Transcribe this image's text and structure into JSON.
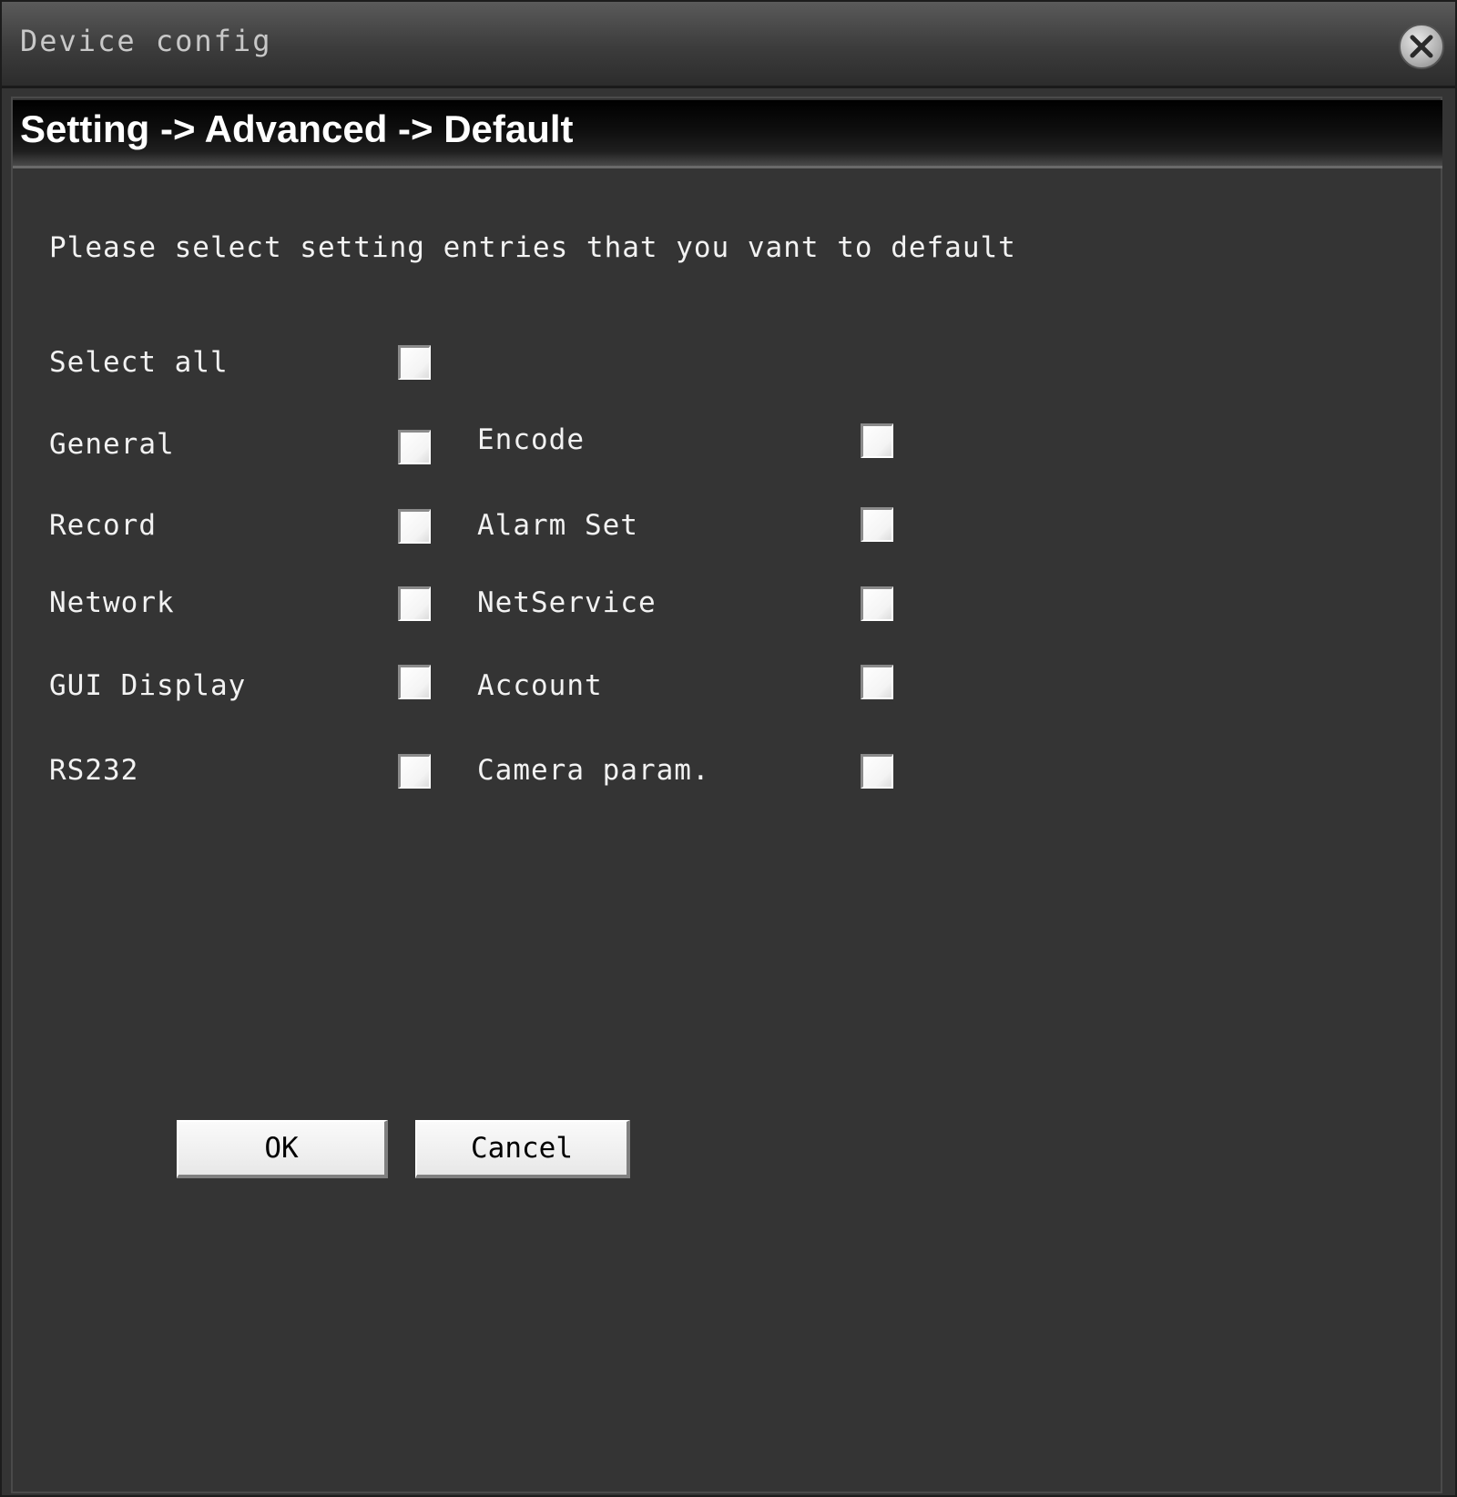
{
  "window": {
    "title": "Device config",
    "close_icon": "close-icon"
  },
  "breadcrumb": "Setting -> Advanced -> Default",
  "instruction": "Please select setting entries that you vant to default",
  "options": {
    "select_all": {
      "label": "Select all",
      "checked": false
    },
    "general": {
      "label": "General",
      "checked": false
    },
    "encode": {
      "label": "Encode",
      "checked": false
    },
    "record": {
      "label": "Record",
      "checked": false
    },
    "alarm_set": {
      "label": "Alarm Set",
      "checked": false
    },
    "network": {
      "label": "Network",
      "checked": false
    },
    "netservice": {
      "label": "NetService",
      "checked": false
    },
    "gui_display": {
      "label": "GUI Display",
      "checked": false
    },
    "account": {
      "label": "Account",
      "checked": false
    },
    "rs232": {
      "label": "RS232",
      "checked": false
    },
    "camera_param": {
      "label": "Camera param.",
      "checked": false
    }
  },
  "buttons": {
    "ok": "OK",
    "cancel": "Cancel"
  }
}
